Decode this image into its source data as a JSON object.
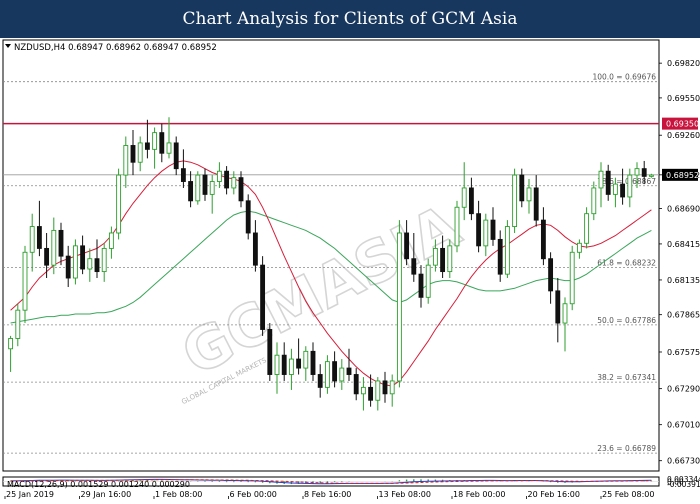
{
  "banner": {
    "title": "Chart Analysis for Clients of GCM Asia"
  },
  "watermark": {
    "text": "GCMASIA",
    "subtext": "GLOBAL CAPITAL MARKETS"
  },
  "colors": {
    "bull": "#2e9e2e",
    "bear": "#111111",
    "red_ma": "#d61e3a",
    "green_ma": "#3aa65a",
    "resistance": "#c8143c",
    "fib": "#888888",
    "macd_line": "#2b3bd4",
    "signal_line": "#d62020",
    "hist": "#2e9e2e",
    "banner": "#17375e"
  },
  "chart_data": [
    {
      "type": "candlestick",
      "header": "NZDUSD,H4  0.68947 0.68962 0.68947 0.68952",
      "ylim": [
        0.6665,
        0.7
      ],
      "y_ticks": [
        "0.69820",
        "0.69550",
        "0.69260",
        "0.68952",
        "0.68690",
        "0.68415",
        "0.68135",
        "0.67865",
        "0.67575",
        "0.67290",
        "0.67010",
        "0.66730"
      ],
      "x_ticks": [
        "25 Jan 2019",
        "29 Jan 16:00",
        "1 Feb 08:00",
        "6 Feb 00:00",
        "8 Feb 16:00",
        "13 Feb 08:00",
        "18 Feb 00:00",
        "20 Feb 16:00",
        "25 Feb 08:00"
      ],
      "fib_levels": [
        {
          "label": "100.0 = 0.69676",
          "value": 0.69676
        },
        {
          "label": "78.6 = 0.68867",
          "value": 0.68867
        },
        {
          "label": "61.8 = 0.68232",
          "value": 0.68232
        },
        {
          "label": "50.0 = 0.67786",
          "value": 0.67786
        },
        {
          "label": "38.2 = 0.67341",
          "value": 0.67341
        },
        {
          "label": "23.6 = 0.66789",
          "value": 0.66789
        }
      ],
      "resistance": {
        "label": "0.69350",
        "value": 0.6935
      },
      "last_price": {
        "label": "0.68952",
        "value": 0.68952
      },
      "candles": [
        [
          0.676,
          0.677,
          0.6742,
          0.6768
        ],
        [
          0.6768,
          0.6795,
          0.6762,
          0.679
        ],
        [
          0.679,
          0.684,
          0.678,
          0.6835
        ],
        [
          0.6835,
          0.6865,
          0.682,
          0.6855
        ],
        [
          0.6855,
          0.6875,
          0.6832,
          0.6838
        ],
        [
          0.6838,
          0.685,
          0.6815,
          0.6825
        ],
        [
          0.6825,
          0.6862,
          0.6818,
          0.6852
        ],
        [
          0.6852,
          0.6858,
          0.6825,
          0.6832
        ],
        [
          0.6832,
          0.684,
          0.6808,
          0.6815
        ],
        [
          0.6815,
          0.6845,
          0.681,
          0.684
        ],
        [
          0.684,
          0.6848,
          0.6818,
          0.6822
        ],
        [
          0.6822,
          0.6838,
          0.6812,
          0.683
        ],
        [
          0.683,
          0.6845,
          0.6815,
          0.682
        ],
        [
          0.682,
          0.6842,
          0.6812,
          0.6838
        ],
        [
          0.6838,
          0.6855,
          0.683,
          0.685
        ],
        [
          0.685,
          0.69,
          0.6845,
          0.6895
        ],
        [
          0.6895,
          0.6925,
          0.6885,
          0.6918
        ],
        [
          0.6918,
          0.693,
          0.6895,
          0.6905
        ],
        [
          0.6905,
          0.6925,
          0.6898,
          0.692
        ],
        [
          0.692,
          0.6938,
          0.6908,
          0.6915
        ],
        [
          0.6915,
          0.6932,
          0.69,
          0.6928
        ],
        [
          0.6928,
          0.6935,
          0.6905,
          0.6912
        ],
        [
          0.6912,
          0.694,
          0.6908,
          0.692
        ],
        [
          0.692,
          0.6925,
          0.6895,
          0.69
        ],
        [
          0.69,
          0.6915,
          0.6885,
          0.689
        ],
        [
          0.689,
          0.6898,
          0.687,
          0.6875
        ],
        [
          0.6875,
          0.6898,
          0.6872,
          0.6895
        ],
        [
          0.6895,
          0.69,
          0.6875,
          0.688
        ],
        [
          0.688,
          0.6895,
          0.6865,
          0.689
        ],
        [
          0.689,
          0.6905,
          0.6885,
          0.6898
        ],
        [
          0.6898,
          0.6902,
          0.688,
          0.6885
        ],
        [
          0.6885,
          0.6898,
          0.688,
          0.6893
        ],
        [
          0.6893,
          0.6898,
          0.687,
          0.6875
        ],
        [
          0.6875,
          0.688,
          0.6845,
          0.685
        ],
        [
          0.685,
          0.686,
          0.682,
          0.6825
        ],
        [
          0.6825,
          0.6832,
          0.677,
          0.6775
        ],
        [
          0.6775,
          0.678,
          0.6735,
          0.674
        ],
        [
          0.674,
          0.6765,
          0.6725,
          0.6755
        ],
        [
          0.6755,
          0.6765,
          0.6735,
          0.674
        ],
        [
          0.674,
          0.676,
          0.6728,
          0.6752
        ],
        [
          0.6752,
          0.6768,
          0.674,
          0.6745
        ],
        [
          0.6745,
          0.6762,
          0.6735,
          0.6758
        ],
        [
          0.6758,
          0.6765,
          0.6735,
          0.674
        ],
        [
          0.674,
          0.6748,
          0.6722,
          0.673
        ],
        [
          0.673,
          0.6755,
          0.6725,
          0.675
        ],
        [
          0.675,
          0.6758,
          0.673,
          0.6735
        ],
        [
          0.6735,
          0.6752,
          0.6728,
          0.6745
        ],
        [
          0.6745,
          0.676,
          0.6735,
          0.674
        ],
        [
          0.674,
          0.6745,
          0.672,
          0.6725
        ],
        [
          0.6725,
          0.6738,
          0.6712,
          0.673
        ],
        [
          0.673,
          0.674,
          0.6715,
          0.672
        ],
        [
          0.672,
          0.6738,
          0.6712,
          0.6735
        ],
        [
          0.6735,
          0.6742,
          0.6718,
          0.6725
        ],
        [
          0.6725,
          0.674,
          0.6715,
          0.6735
        ],
        [
          0.6735,
          0.686,
          0.673,
          0.685
        ],
        [
          0.685,
          0.686,
          0.6825,
          0.683
        ],
        [
          0.683,
          0.685,
          0.6812,
          0.6818
        ],
        [
          0.6818,
          0.6825,
          0.6792,
          0.68
        ],
        [
          0.68,
          0.683,
          0.6795,
          0.6825
        ],
        [
          0.6825,
          0.6845,
          0.682,
          0.6838
        ],
        [
          0.6838,
          0.6848,
          0.6815,
          0.682
        ],
        [
          0.682,
          0.6845,
          0.6815,
          0.684
        ],
        [
          0.684,
          0.6875,
          0.6835,
          0.687
        ],
        [
          0.687,
          0.6905,
          0.686,
          0.6885
        ],
        [
          0.6885,
          0.6893,
          0.686,
          0.6865
        ],
        [
          0.6865,
          0.6875,
          0.6835,
          0.684
        ],
        [
          0.684,
          0.6865,
          0.6832,
          0.686
        ],
        [
          0.686,
          0.687,
          0.684,
          0.6845
        ],
        [
          0.6845,
          0.6852,
          0.6812,
          0.6818
        ],
        [
          0.6818,
          0.686,
          0.6815,
          0.6855
        ],
        [
          0.6855,
          0.69,
          0.685,
          0.6895
        ],
        [
          0.6895,
          0.69,
          0.687,
          0.6875
        ],
        [
          0.6875,
          0.6892,
          0.6865,
          0.6885
        ],
        [
          0.6885,
          0.6895,
          0.6855,
          0.686
        ],
        [
          0.686,
          0.687,
          0.6825,
          0.683
        ],
        [
          0.683,
          0.6835,
          0.6795,
          0.6805
        ],
        [
          0.6805,
          0.6815,
          0.6765,
          0.678
        ],
        [
          0.678,
          0.68,
          0.6758,
          0.6795
        ],
        [
          0.6795,
          0.684,
          0.679,
          0.6835
        ],
        [
          0.6835,
          0.6845,
          0.683,
          0.6842
        ],
        [
          0.6842,
          0.687,
          0.6838,
          0.6865
        ],
        [
          0.6865,
          0.689,
          0.686,
          0.6885
        ],
        [
          0.6885,
          0.6905,
          0.687,
          0.6898
        ],
        [
          0.6898,
          0.6903,
          0.6875,
          0.688
        ],
        [
          0.688,
          0.6893,
          0.687,
          0.6888
        ],
        [
          0.6888,
          0.69,
          0.6872,
          0.6878
        ],
        [
          0.6878,
          0.69,
          0.687,
          0.6895
        ],
        [
          0.6895,
          0.6905,
          0.6885,
          0.69
        ],
        [
          0.69,
          0.6906,
          0.6888,
          0.6894
        ],
        [
          0.6894,
          0.6896,
          0.6893,
          0.6895
        ]
      ],
      "ma_red": [
        0.679,
        0.6795,
        0.68,
        0.6808,
        0.6815,
        0.682,
        0.6825,
        0.6828,
        0.683,
        0.6832,
        0.6834,
        0.6836,
        0.6838,
        0.6842,
        0.6848,
        0.6856,
        0.6865,
        0.6873,
        0.688,
        0.6887,
        0.6893,
        0.6898,
        0.6902,
        0.6905,
        0.6906,
        0.6905,
        0.6903,
        0.69,
        0.6897,
        0.6895,
        0.6893,
        0.6892,
        0.689,
        0.6886,
        0.688,
        0.687,
        0.6858,
        0.6845,
        0.6832,
        0.682,
        0.6808,
        0.6797,
        0.6788,
        0.678,
        0.6772,
        0.6765,
        0.6758,
        0.6752,
        0.6746,
        0.6741,
        0.6737,
        0.6734,
        0.6732,
        0.6731,
        0.6735,
        0.6742,
        0.675,
        0.6758,
        0.6766,
        0.6775,
        0.6783,
        0.6791,
        0.6799,
        0.6808,
        0.6816,
        0.6823,
        0.6829,
        0.6834,
        0.6838,
        0.6841,
        0.6845,
        0.6849,
        0.6853,
        0.6856,
        0.6857,
        0.6856,
        0.6852,
        0.6847,
        0.6843,
        0.684,
        0.6839,
        0.684,
        0.6842,
        0.6845,
        0.6848,
        0.6852,
        0.6856,
        0.686,
        0.6864,
        0.6868
      ],
      "ma_green": [
        0.678,
        0.6781,
        0.6782,
        0.6783,
        0.6784,
        0.6785,
        0.6785,
        0.6786,
        0.6786,
        0.6787,
        0.6787,
        0.6787,
        0.6788,
        0.6788,
        0.6789,
        0.6791,
        0.6793,
        0.6796,
        0.68,
        0.6805,
        0.681,
        0.6815,
        0.682,
        0.6825,
        0.683,
        0.6835,
        0.684,
        0.6845,
        0.685,
        0.6855,
        0.686,
        0.6864,
        0.6866,
        0.6867,
        0.6866,
        0.6864,
        0.6862,
        0.686,
        0.6858,
        0.6856,
        0.6854,
        0.6852,
        0.6849,
        0.6846,
        0.6842,
        0.6838,
        0.6833,
        0.6828,
        0.6823,
        0.6818,
        0.6813,
        0.6808,
        0.6803,
        0.6798,
        0.6796,
        0.6798,
        0.6802,
        0.6806,
        0.681,
        0.6812,
        0.6813,
        0.6813,
        0.6812,
        0.681,
        0.6808,
        0.6806,
        0.6805,
        0.6805,
        0.6805,
        0.6806,
        0.6807,
        0.6809,
        0.6811,
        0.6813,
        0.6814,
        0.6815,
        0.6814,
        0.6813,
        0.6813,
        0.6815,
        0.6818,
        0.6822,
        0.6826,
        0.683,
        0.6834,
        0.6838,
        0.6842,
        0.6846,
        0.6849,
        0.6852
      ]
    },
    {
      "type": "line",
      "header": "MACD(12,26,9) 0.001529 0.001240 0.000290",
      "ylim": [
        -0.00391,
        0.00344
      ],
      "y_ticks": [
        "0.003344",
        "0.00",
        "-0.003914"
      ],
      "series": [
        {
          "name": "MACD",
          "values": [
            0.0008,
            0.0009,
            0.0011,
            0.0013,
            0.0015,
            0.0016,
            0.0017,
            0.0018,
            0.0018,
            0.0017,
            0.0016,
            0.0015,
            0.0014,
            0.0014,
            0.0015,
            0.0018,
            0.0021,
            0.0024,
            0.0026,
            0.0027,
            0.0028,
            0.0028,
            0.0027,
            0.0026,
            0.0024,
            0.0022,
            0.002,
            0.0018,
            0.0016,
            0.0015,
            0.0013,
            0.0012,
            0.0011,
            0.0009,
            0.0006,
            0.0001,
            -0.0006,
            -0.0013,
            -0.0019,
            -0.0024,
            -0.0028,
            -0.0031,
            -0.0033,
            -0.0034,
            -0.0034,
            -0.0033,
            -0.0032,
            -0.0031,
            -0.003,
            -0.003,
            -0.003,
            -0.003,
            -0.0029,
            -0.0028,
            -0.002,
            -0.0012,
            -0.0006,
            -0.0002,
            0.0001,
            0.0003,
            0.0005,
            0.0006,
            0.0008,
            0.001,
            0.0012,
            0.0013,
            0.0014,
            0.0014,
            0.0012,
            0.0011,
            0.0012,
            0.0013,
            0.0013,
            0.0012,
            0.0009,
            0.0004,
            -0.0002,
            -0.0006,
            -0.0007,
            -0.0006,
            -0.0003,
            0.0,
            0.0003,
            0.0006,
            0.0008,
            0.0009,
            0.0011,
            0.0012,
            0.0014,
            0.0015
          ]
        },
        {
          "name": "Signal",
          "values": [
            0.0004,
            0.0005,
            0.0006,
            0.0007,
            0.0008,
            0.001,
            0.0011,
            0.0012,
            0.0013,
            0.0014,
            0.0014,
            0.0014,
            0.0014,
            0.0014,
            0.0014,
            0.0015,
            0.0016,
            0.0017,
            0.0019,
            0.002,
            0.0022,
            0.0023,
            0.0024,
            0.0024,
            0.0024,
            0.0024,
            0.0023,
            0.0022,
            0.0021,
            0.002,
            0.0019,
            0.0018,
            0.0016,
            0.0015,
            0.0013,
            0.0011,
            0.0008,
            0.0004,
            0.0,
            -0.0004,
            -0.0009,
            -0.0013,
            -0.0017,
            -0.0021,
            -0.0024,
            -0.0026,
            -0.0028,
            -0.0029,
            -0.003,
            -0.003,
            -0.003,
            -0.003,
            -0.003,
            -0.003,
            -0.0028,
            -0.0025,
            -0.0021,
            -0.0017,
            -0.0013,
            -0.001,
            -0.0007,
            -0.0004,
            -0.0002,
            0.0,
            0.0002,
            0.0004,
            0.0006,
            0.0008,
            0.0009,
            0.001,
            0.001,
            0.0011,
            0.0011,
            0.0012,
            0.0011,
            0.001,
            0.0008,
            0.0005,
            0.0002,
            0.0,
            -0.0001,
            -0.0001,
            0.0,
            0.0001,
            0.0003,
            0.0004,
            0.0006,
            0.0007,
            0.0009,
            0.001
          ]
        }
      ]
    }
  ]
}
